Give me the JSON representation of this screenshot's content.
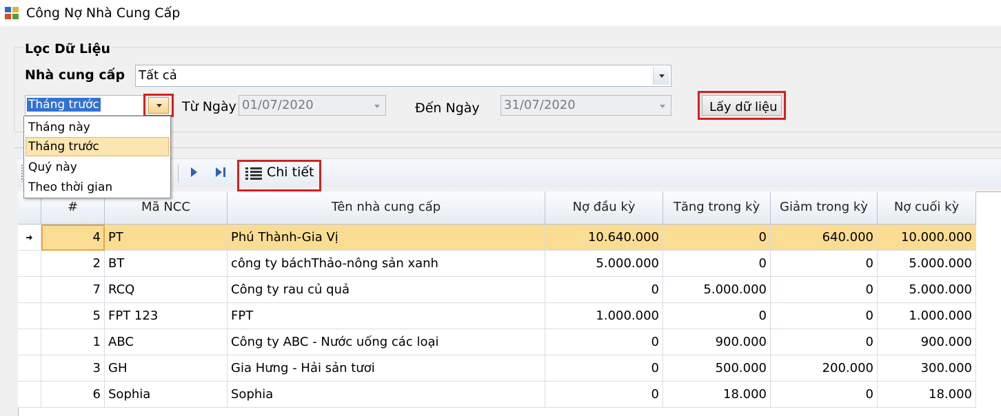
{
  "window": {
    "title": "Công Nợ Nhà Cung Cấp"
  },
  "filter": {
    "group_title": "Lọc Dữ Liệu",
    "supplier_label": "Nhà cung cấp",
    "supplier_value": "Tất cả",
    "period_value": "Tháng trước",
    "period_options": [
      "Tháng này",
      "Tháng trước",
      "Quý này",
      "Theo thời gian"
    ],
    "from_label": "Từ Ngày",
    "from_value": "01/07/2020",
    "to_label": "Đến Ngày",
    "to_value": "31/07/2020",
    "fetch_label": "Lấy dữ liệu"
  },
  "toolbar": {
    "detail_label": "Chi tiết"
  },
  "grid": {
    "headers": [
      "#",
      "Mã NCC",
      "Tên nhà cung cấp",
      "Nợ đầu kỳ",
      "Tăng trong kỳ",
      "Giảm trong kỳ",
      "Nợ cuối kỳ"
    ],
    "rows": [
      [
        "4",
        "PT",
        "Phú Thành-Gia Vị",
        "10.640.000",
        "0",
        "640.000",
        "10.000.000"
      ],
      [
        "2",
        "BT",
        "công ty báchThảo-nông sản xanh",
        "5.000.000",
        "0",
        "0",
        "5.000.000"
      ],
      [
        "7",
        "RCQ",
        "Công ty rau củ quả",
        "0",
        "5.000.000",
        "0",
        "5.000.000"
      ],
      [
        "5",
        "FPT 123",
        "FPT",
        "1.000.000",
        "0",
        "0",
        "1.000.000"
      ],
      [
        "1",
        "ABC",
        "Công ty ABC - Nước uống các loại",
        "0",
        "900.000",
        "0",
        "900.000"
      ],
      [
        "3",
        "GH",
        "Gia Hưng - Hải sản tươi",
        "0",
        "500.000",
        "200.000",
        "300.000"
      ],
      [
        "6",
        "Sophia",
        "Sophia",
        "0",
        "18.000",
        "0",
        "18.000"
      ]
    ],
    "selected_row": 0
  },
  "colors": {
    "highlight": "#d42020",
    "selected_row": "#fbdc93",
    "dropdown_selected": "#fbe5b0"
  }
}
